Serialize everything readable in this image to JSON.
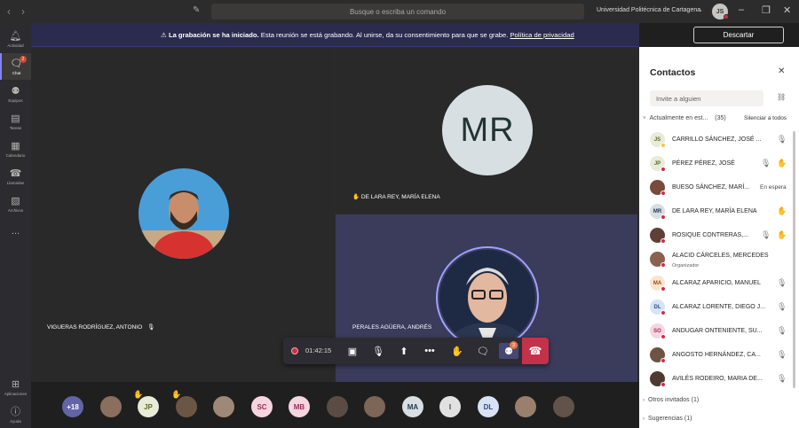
{
  "titlebar": {
    "search_placeholder": "Busque o escriba un comando",
    "org": "Universidad Politécnica de Cartagena",
    "me_initials": "JS"
  },
  "rail": {
    "items": [
      {
        "label": "Actividad",
        "icon": "bell-icon"
      },
      {
        "label": "Chat",
        "icon": "chat-icon",
        "badge": "2"
      },
      {
        "label": "Equipos",
        "icon": "teams-icon"
      },
      {
        "label": "Tareas",
        "icon": "tasks-icon"
      },
      {
        "label": "Calendario",
        "icon": "calendar-icon"
      },
      {
        "label": "Llamadas",
        "icon": "phone-icon"
      },
      {
        "label": "Archivos",
        "icon": "files-icon"
      },
      {
        "label": "...",
        "icon": "more-icon"
      }
    ],
    "bottom": [
      {
        "label": "Aplicaciones",
        "icon": "apps-icon"
      },
      {
        "label": "Ayuda",
        "icon": "help-icon"
      }
    ]
  },
  "banner": {
    "bold": "La grabación se ha iniciado.",
    "text": " Esta reunión se está grabando. Al unirse, da su consentimiento para que se grabe. ",
    "link": "Política de privacidad",
    "dismiss": "Descartar"
  },
  "tiles": {
    "left_name": "VIGUERAS RODRÍGUEZ, ANTONIO",
    "top_right_initials": "MR",
    "top_right_name": "DE LARA REY, MARÍA ELENA",
    "bottom_right_name": "PERALES AGÜERA, ANDRÉS"
  },
  "controls": {
    "timer": "01:42:15",
    "participants_badge": "3"
  },
  "strip": [
    {
      "label": "+18",
      "bg": "#6264a7",
      "fg": "#ffffff"
    },
    {
      "label": "",
      "photo": true
    },
    {
      "label": "JP",
      "bg": "#e8ebd7",
      "fg": "#5b6b2a",
      "hand": true
    },
    {
      "label": "",
      "photo": true,
      "hand": true
    },
    {
      "label": "",
      "photo": true
    },
    {
      "label": "SC",
      "bg": "#f6d5e0",
      "fg": "#9b2c56"
    },
    {
      "label": "MB",
      "bg": "#f6d5e0",
      "fg": "#9b2c56"
    },
    {
      "label": "",
      "photo": true
    },
    {
      "label": "",
      "photo": true
    },
    {
      "label": "MA",
      "bg": "#d7dfe3",
      "fg": "#233a4e"
    },
    {
      "label": "I",
      "bg": "#e1e1e1",
      "fg": "#444444"
    },
    {
      "label": "DL",
      "bg": "#d7e3f4",
      "fg": "#2c4f8a"
    },
    {
      "label": "",
      "photo": true
    },
    {
      "label": "",
      "photo": true
    }
  ],
  "panel": {
    "title": "Contactos",
    "invite_placeholder": "Invite a alguien",
    "current_section": "Actualmente en est...",
    "current_count": "(35)",
    "mute_all": "Silenciar a todos",
    "participants": [
      {
        "initials": "JS",
        "name": "CARRILLO SÁNCHEZ, JOSÉ ...",
        "bg": "#e8ebd7",
        "fg": "#5b6b2a",
        "dot": "#f8c34a",
        "mic_off": true,
        "hand": false,
        "status": "",
        "role": ""
      },
      {
        "initials": "JP",
        "name": "PÉREZ PÉREZ, JOSÉ",
        "bg": "#e8ebd7",
        "fg": "#5b6b2a",
        "dot": "#c4314b",
        "mic_off": true,
        "hand": true,
        "status": "",
        "role": ""
      },
      {
        "initials": "",
        "photo": true,
        "name": "BUESO SÁNCHEZ, MARÍ...",
        "dot": "#c4314b",
        "mic_off": false,
        "hand": false,
        "status": "En espera",
        "role": ""
      },
      {
        "initials": "MR",
        "name": "DE LARA REY, MARÍA ELENA",
        "bg": "#d7dfe3",
        "fg": "#233a4e",
        "dot": "#c4314b",
        "mic_off": false,
        "hand": true,
        "status": "",
        "role": ""
      },
      {
        "initials": "",
        "photo": true,
        "name": "ROSIQUE CONTRERAS,...",
        "dot": "#c4314b",
        "mic_off": true,
        "hand": true,
        "status": "",
        "role": ""
      },
      {
        "initials": "",
        "photo": true,
        "name": "ALACID CÁRCELES, MERCEDES",
        "dot": "#c4314b",
        "mic_off": false,
        "hand": false,
        "status": "",
        "role": "Organizador"
      },
      {
        "initials": "MA",
        "name": "ALCARAZ APARICIO, MANUEL",
        "bg": "#fbe3d0",
        "fg": "#9a4b12",
        "dot": "#c4314b",
        "mic_off": true,
        "hand": false,
        "status": "",
        "role": ""
      },
      {
        "initials": "DL",
        "name": "ALCARAZ LORENTE, DIEGO J...",
        "bg": "#d7e3f4",
        "fg": "#2c4f8a",
        "dot": "#c4314b",
        "mic_off": true,
        "hand": false,
        "status": "",
        "role": ""
      },
      {
        "initials": "SO",
        "name": "ANDUGAR ONTENIENTE, SU...",
        "bg": "#f6d5e0",
        "fg": "#9b2c56",
        "dot": "#c4314b",
        "mic_off": true,
        "hand": false,
        "status": "",
        "role": ""
      },
      {
        "initials": "",
        "photo": true,
        "name": "ANGOSTO HERNÁNDEZ, CA...",
        "dot": "#c4314b",
        "mic_off": true,
        "hand": false,
        "status": "",
        "role": ""
      },
      {
        "initials": "",
        "photo": true,
        "name": "AVILÉS RODEIRO, MARIA DE...",
        "dot": "#c4314b",
        "mic_off": true,
        "hand": false,
        "status": "",
        "role": ""
      }
    ],
    "other_invited": "Otros invitados (1)",
    "suggestions": "Sugerencias (1)"
  }
}
